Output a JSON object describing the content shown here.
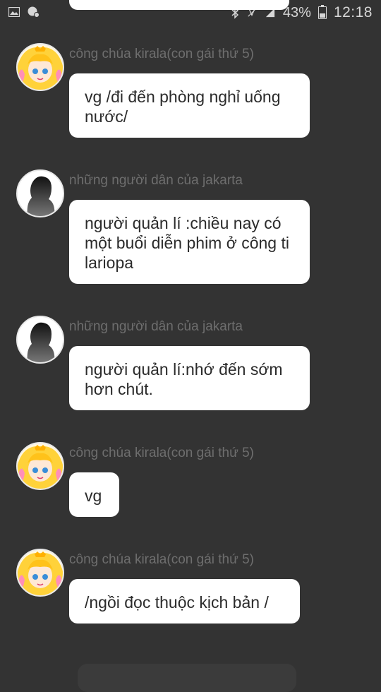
{
  "status_bar": {
    "left_icons": [
      "image-icon",
      "messenger-icon"
    ],
    "right_icons": [
      "bluetooth-icon",
      "silent-icon",
      "signal-icon"
    ],
    "battery_percent": "43%",
    "battery_level": 0.43,
    "time": "12:18"
  },
  "messages": [
    {
      "sender": "công chúa kirala(con gái thứ 5)",
      "avatar": "princess-avatar",
      "text": "vg /đi đến phòng nghỉ uống nước/"
    },
    {
      "sender": "những người dân của jakarta",
      "avatar": "silhouette-avatar",
      "text": "người quản lí :chiều nay có một buổi diễn phim ở công ti lariopa"
    },
    {
      "sender": "những người dân của jakarta",
      "avatar": "silhouette-avatar",
      "text": "người quản lí:nhớ đến sớm hơn chút."
    },
    {
      "sender": "công chúa kirala(con gái thứ 5)",
      "avatar": "princess-avatar",
      "text": "vg"
    },
    {
      "sender": "công chúa kirala(con gái thứ 5)",
      "avatar": "princess-avatar",
      "text": "/ngồi đọc thuộc kịch bản /"
    }
  ],
  "colors": {
    "background": "#333333",
    "bubble": "#ffffff",
    "sender_text": "#6e6e6e",
    "message_text": "#2b2b2b"
  }
}
